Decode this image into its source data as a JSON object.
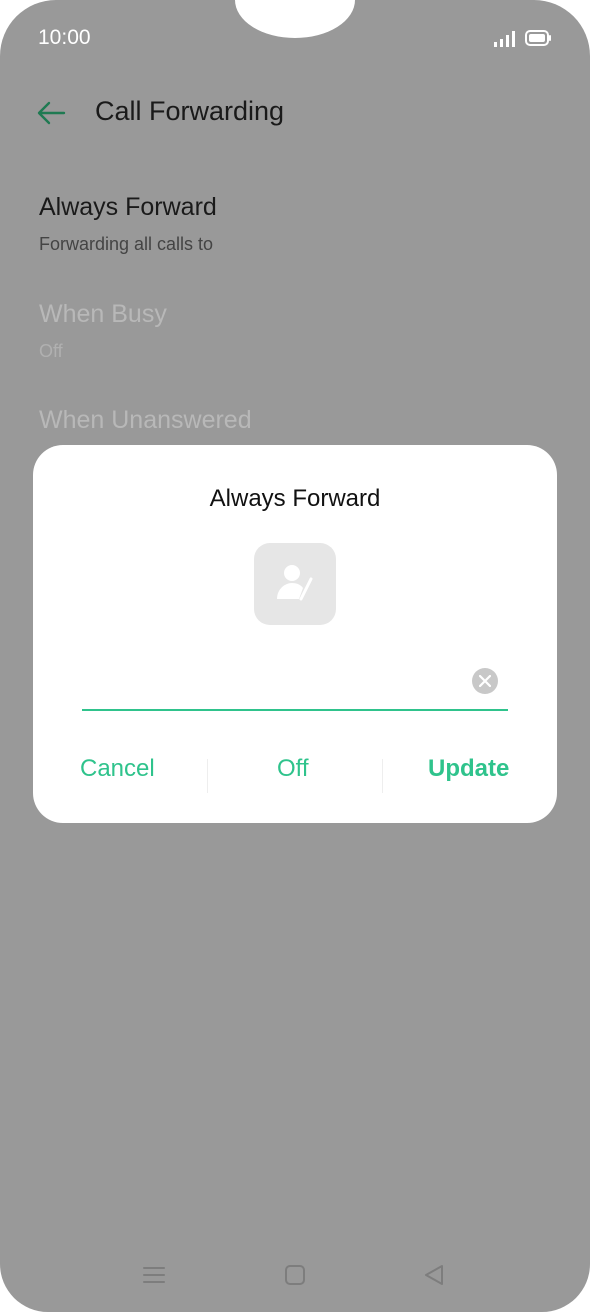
{
  "status_bar": {
    "time": "10:00"
  },
  "app_bar": {
    "title": "Call Forwarding"
  },
  "settings": [
    {
      "title": "Always Forward",
      "subtitle": "Forwarding all calls to",
      "enabled": true
    },
    {
      "title": "When Busy",
      "subtitle": "Off",
      "enabled": false
    },
    {
      "title": "When Unanswered",
      "subtitle": "",
      "enabled": false
    }
  ],
  "dialog": {
    "title": "Always Forward",
    "number_value": "",
    "buttons": {
      "cancel": "Cancel",
      "off": "Off",
      "update": "Update"
    }
  },
  "colors": {
    "accent": "#2fc38c",
    "scrim": "#999999"
  },
  "icons": [
    "back-arrow-icon",
    "signal-icon",
    "battery-icon",
    "contact-edit-icon",
    "clear-icon",
    "menu-icon",
    "home-icon",
    "back-icon"
  ]
}
